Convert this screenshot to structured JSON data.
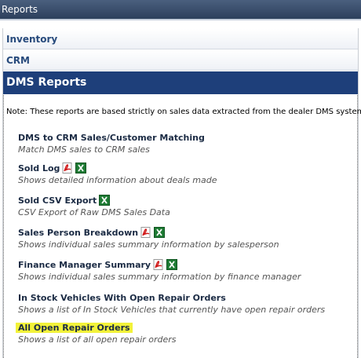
{
  "header": {
    "title": "Reports"
  },
  "sections": [
    {
      "label": "Inventory"
    },
    {
      "label": "CRM"
    },
    {
      "label": "DMS Reports"
    }
  ],
  "note": "Note: These reports are based strictly on sales data extracted from the dealer DMS system.",
  "reports": [
    {
      "title": "DMS to CRM Sales/Customer Matching",
      "description": "Match DMS sales to CRM sales",
      "icons": []
    },
    {
      "title": "Sold Log",
      "description": "Shows detailed information about deals made",
      "icons": [
        "pdf-icon",
        "excel-icon"
      ]
    },
    {
      "title": "Sold CSV Export",
      "description": "CSV Export of Raw DMS Sales Data",
      "icons": [
        "excel-icon"
      ]
    },
    {
      "title": "Sales Person Breakdown",
      "description": "Shows individual sales summary information by salesperson",
      "icons": [
        "pdf-icon",
        "excel-icon"
      ]
    },
    {
      "title": "Finance Manager Summary",
      "description": "Shows individual sales summary information by finance manager",
      "icons": [
        "pdf-icon",
        "excel-icon"
      ]
    },
    {
      "title": "In Stock Vehicles With Open Repair Orders",
      "description": "Shows a list of In Stock Vehicles that currently have open repair orders",
      "icons": []
    },
    {
      "title": "All Open Repair Orders",
      "description": "Shows a list of all open repair orders",
      "icons": [],
      "highlighted": true
    }
  ],
  "colors": {
    "highlight": "#f2f23a",
    "active_section": "#1e3f7a",
    "section_text": "#274a7c"
  }
}
